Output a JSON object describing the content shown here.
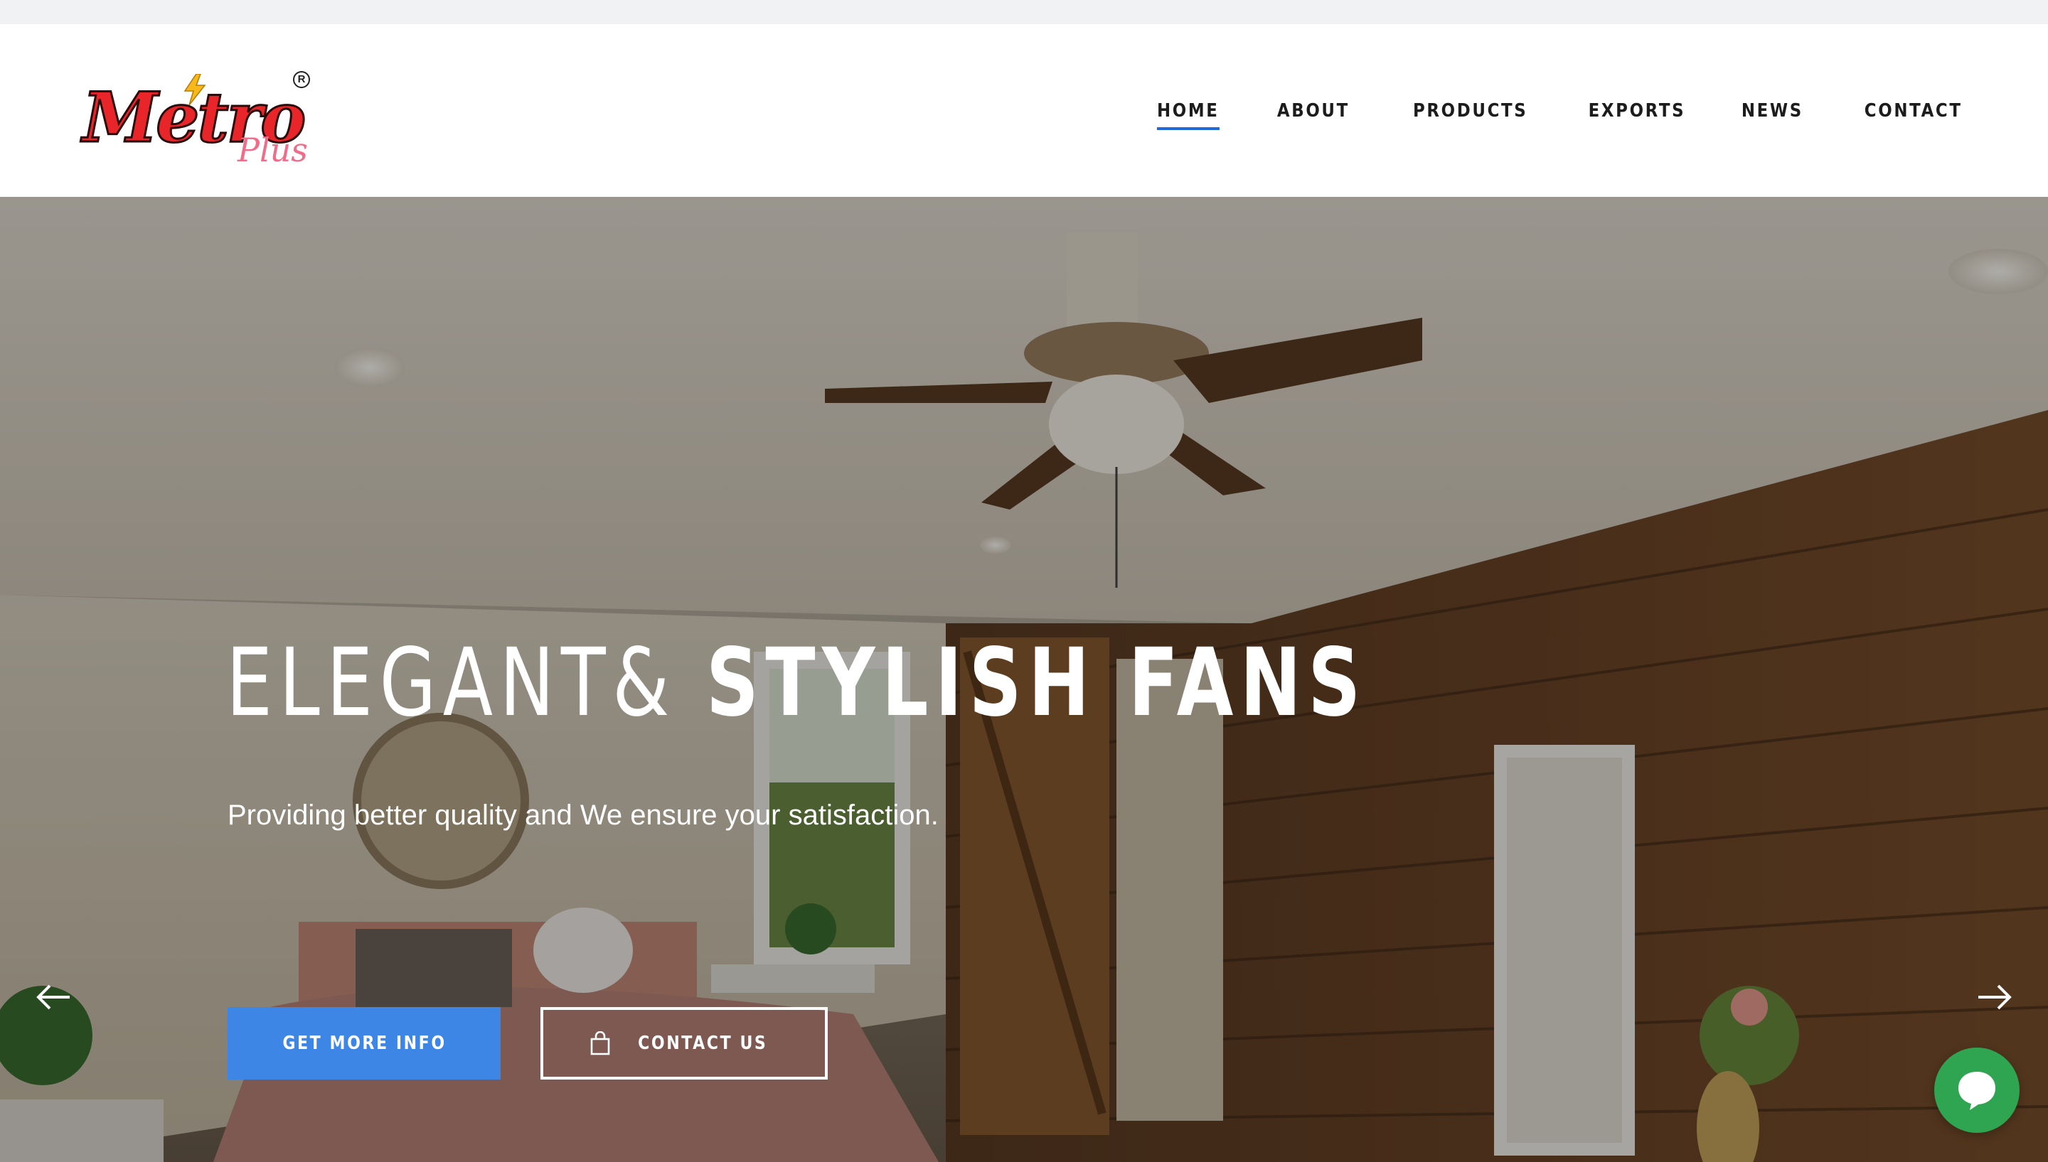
{
  "brand": {
    "logo_text": "Metro",
    "logo_sub": "Plus",
    "registered_mark": "R",
    "colors": {
      "logo_red": "#e8262a",
      "logo_pink": "#f06c8a"
    }
  },
  "nav": {
    "items": [
      {
        "label": "HOME",
        "active": true
      },
      {
        "label": "ABOUT",
        "active": false
      },
      {
        "label": "PRODUCTS",
        "active": false
      },
      {
        "label": "EXPORTS",
        "active": false
      },
      {
        "label": "NEWS",
        "active": false
      },
      {
        "label": "CONTACT",
        "active": false
      }
    ],
    "active_underline_color": "#1e6ad9"
  },
  "hero": {
    "headline_light": "ELEGANT&",
    "headline_bold": "STYLISH FANS",
    "subtitle": "Providing better quality and We ensure your satisfaction.",
    "primary_button": "GET MORE INFO",
    "secondary_button": "CONTACT US",
    "secondary_button_icon": "shopping-bag-icon",
    "prev_icon": "arrow-left-icon",
    "next_icon": "arrow-right-icon",
    "primary_color": "#3d86e6"
  },
  "chat_widget": {
    "icon": "chat-bubble-icon",
    "color": "#2fa451"
  }
}
